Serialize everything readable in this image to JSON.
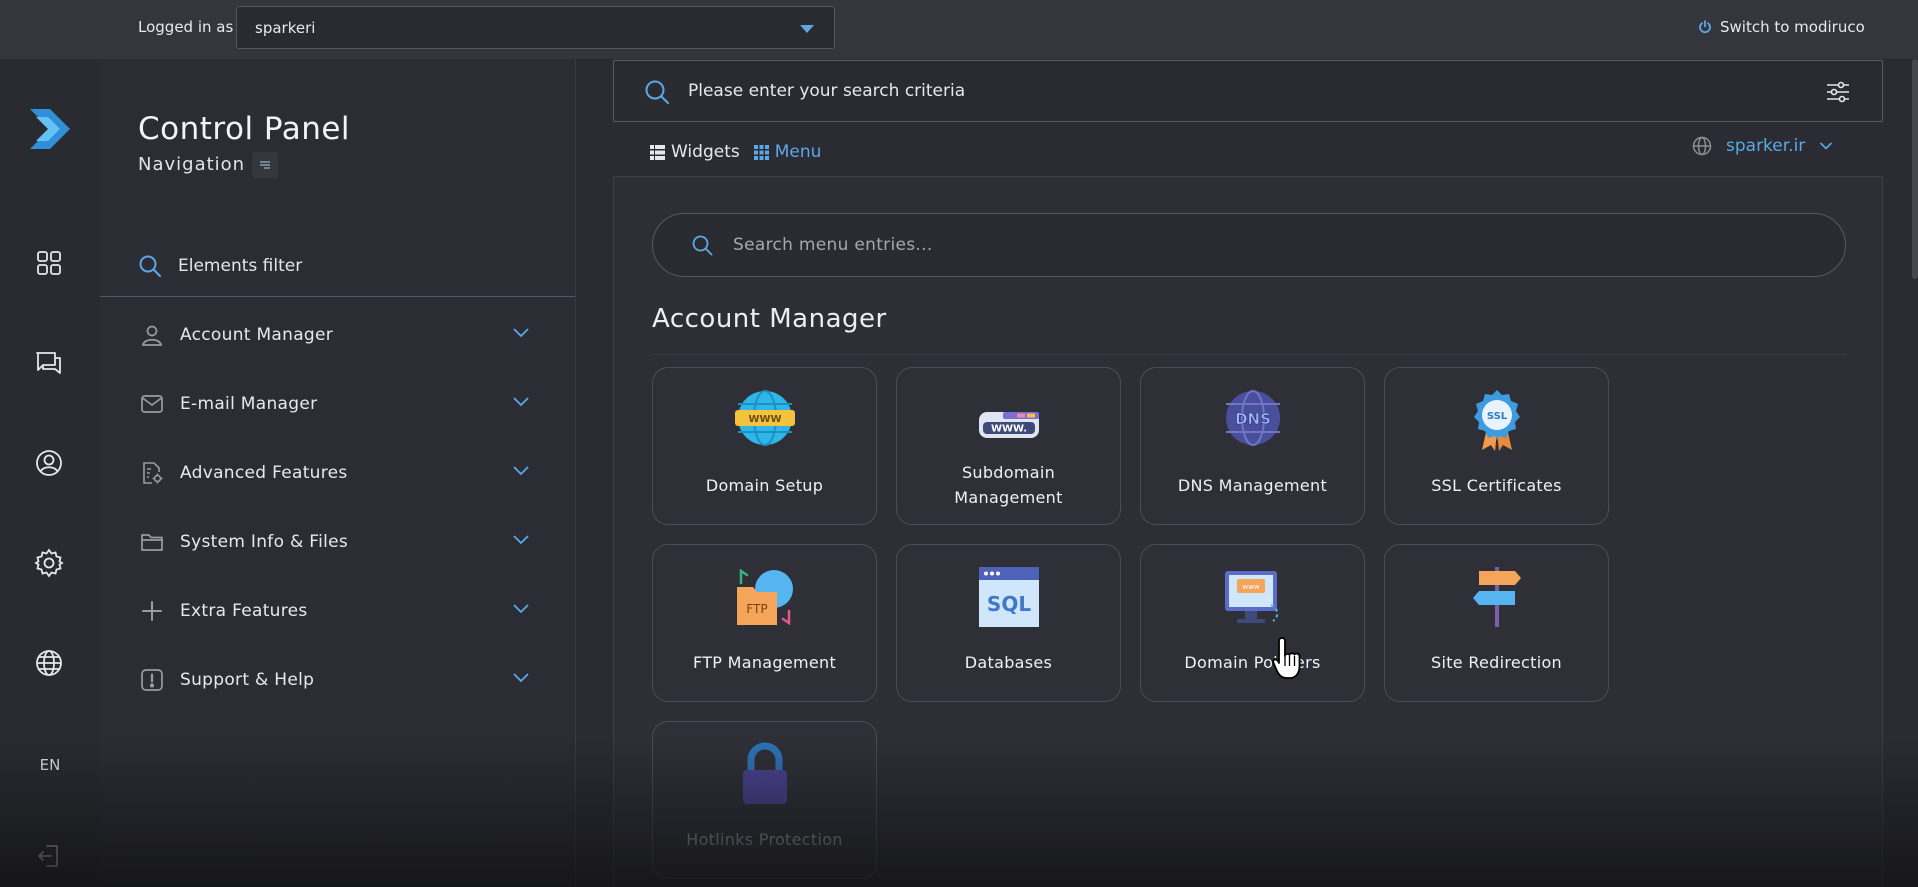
{
  "topbar": {
    "logged_in_label": "Logged in as",
    "user_value": "sparkeri",
    "switch_label": "Switch to modiruco",
    "switch_icon": "power-icon"
  },
  "rail": {
    "icons": [
      "dashboard-grid-icon",
      "chat-icon",
      "user-circle-icon",
      "gear-icon",
      "globe-icon",
      "logout-icon"
    ],
    "language": "EN"
  },
  "nav": {
    "title": "Control Panel",
    "subtitle": "Navigation",
    "filter_label": "Elements filter",
    "items": [
      {
        "label": "Account Manager",
        "icon": "user-icon"
      },
      {
        "label": "E-mail Manager",
        "icon": "mail-icon"
      },
      {
        "label": "Advanced Features",
        "icon": "advanced-settings-icon"
      },
      {
        "label": "System Info & Files",
        "icon": "folder-icon"
      },
      {
        "label": "Extra Features",
        "icon": "plus-icon"
      },
      {
        "label": "Support & Help",
        "icon": "alert-icon"
      }
    ]
  },
  "main": {
    "search_placeholder": "Please enter your search criteria",
    "tabs": [
      {
        "label": "Widgets",
        "active": false
      },
      {
        "label": "Menu",
        "active": true
      }
    ],
    "domain": "sparker.ir",
    "menu_search_placeholder": "Search menu entries...",
    "section_title": "Account Manager",
    "cards": [
      {
        "label": "Domain Setup",
        "icon": "www-globe-icon"
      },
      {
        "label": "Subdomain Management",
        "icon": "www-window-icon"
      },
      {
        "label": "DNS Management",
        "icon": "dns-globe-icon"
      },
      {
        "label": "SSL Certificates",
        "icon": "ssl-badge-icon"
      },
      {
        "label": "FTP Management",
        "icon": "ftp-folder-icon"
      },
      {
        "label": "Databases",
        "icon": "sql-window-icon"
      },
      {
        "label": "Domain Pointers",
        "icon": "domain-pointer-monitor-icon"
      },
      {
        "label": "Site Redirection",
        "icon": "signpost-icon"
      },
      {
        "label": "Hotlinks Protection",
        "icon": "padlock-icon"
      }
    ]
  },
  "colors": {
    "accent": "#5aa9e6",
    "background": "#2b2c33",
    "topbar": "#35363d"
  }
}
